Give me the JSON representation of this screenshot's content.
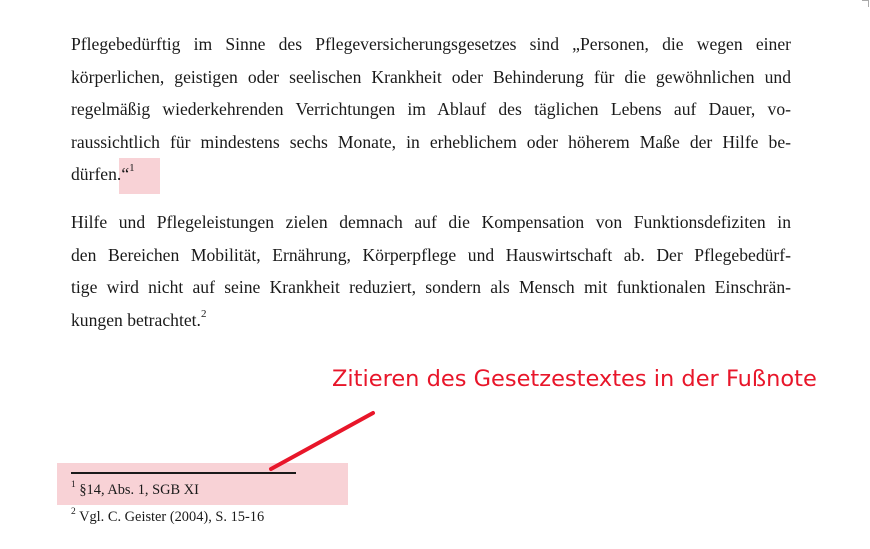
{
  "paragraph1": {
    "lines": [
      "Pflegebedürftig im Sinne des Pflegeversicherungsgesetzes sind „Personen, die wegen einer",
      "körperlichen, geistigen oder seelischen Krankheit oder Behinderung für die gewöhnlichen und",
      "regelmäßig wiederkehrenden Verrichtungen im Ablauf des täglichen Lebens auf Dauer, vo-",
      "raussichtlich für mindestens sechs Monate, in erheblichem oder höherem Maße der Hilfe be-",
      "dürfen.“"
    ],
    "footnote_ref": "1"
  },
  "paragraph2": {
    "lines": [
      "Hilfe und Pflegeleistungen zielen demnach auf die Kompensation von Funktionsdefiziten in",
      "den Bereichen Mobilität, Ernährung, Körperpflege und Hauswirtschaft ab. Der Pflegebedürf-",
      "tige wird nicht auf seine Krankheit reduziert, sondern als Mensch mit funktionalen Einschrän-",
      "kungen betrachtet."
    ],
    "footnote_ref": "2"
  },
  "annotation": {
    "text": "Zitieren des Gesetzestextes in der Fußnote",
    "color": "#e8162a"
  },
  "footnotes": [
    {
      "number": "1",
      "text": "§14, Abs. 1, SGB XI"
    },
    {
      "number": "2",
      "text": "Vgl. C. Geister (2004), S. 15-16"
    }
  ],
  "highlight_color": "#f8d2d6"
}
